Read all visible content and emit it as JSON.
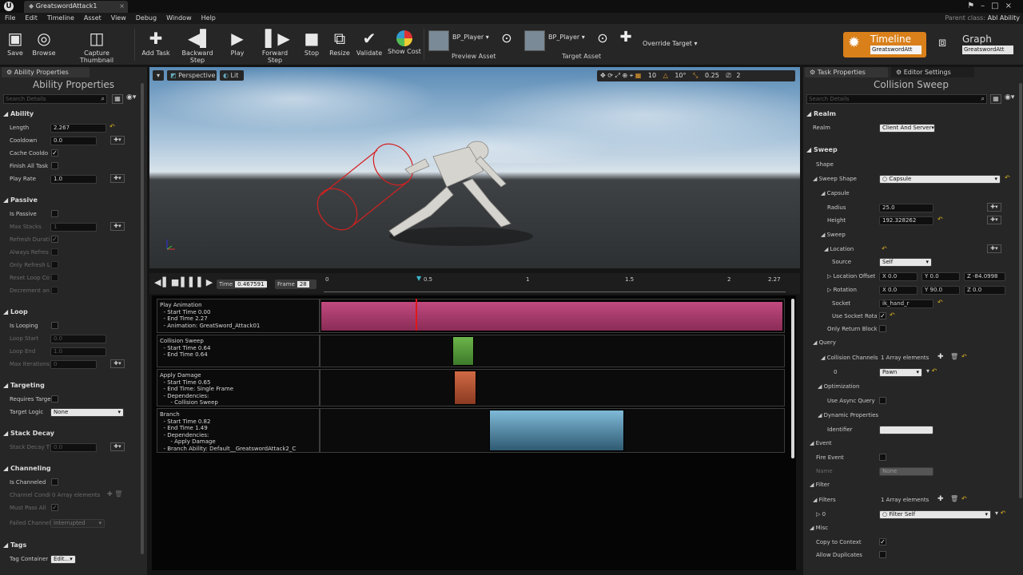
{
  "window": {
    "tab_title": "GreatswordAttack1",
    "parent_class_label": "Parent class:",
    "parent_class_value": "Abl Ability"
  },
  "menu": [
    "File",
    "Edit",
    "Timeline",
    "Asset",
    "View",
    "Debug",
    "Window",
    "Help"
  ],
  "toolbar": {
    "save": "Save",
    "browse": "Browse",
    "capture": "Capture Thumbnail",
    "add_task": "Add Task",
    "backward": "Backward Step",
    "play": "Play",
    "forward": "Forward Step",
    "stop": "Stop",
    "resize": "Resize",
    "validate": "Validate",
    "show_cost": "Show Cost",
    "preview_asset_value": "BP_Player",
    "preview_asset_label": "Preview Asset",
    "target_asset_value": "BP_Player",
    "target_asset_label": "Target Asset",
    "override_target": "Override Target",
    "mode_timeline": "Timeline",
    "mode_timeline_sub": "GreatswordAtt",
    "mode_graph": "Graph",
    "mode_graph_sub": "GreatswordAtt"
  },
  "left_panel": {
    "tab": "Ability Properties",
    "title": "Ability Properties",
    "search_placeholder": "Search Details",
    "ability": {
      "header": "Ability",
      "length_label": "Length",
      "length": "2.267",
      "cooldown_label": "Cooldown",
      "cooldown": "0.0",
      "cache_label": "Cache Cooldo",
      "finish_label": "Finish All Task",
      "playrate_label": "Play Rate",
      "playrate": "1.0"
    },
    "passive": {
      "header": "Passive",
      "is_passive": "Is Passive",
      "max_stacks_label": "Max Stacks",
      "max_stacks": "1",
      "refresh_label": "Refresh Durati",
      "always_label": "Always Refres",
      "only_label": "Only Refresh L",
      "reset_label": "Reset Loop Co",
      "decrement_label": "Decrement an"
    },
    "loop": {
      "header": "Loop",
      "is_looping": "Is Looping",
      "start_label": "Loop Start",
      "start": "0.0",
      "end_label": "Loop End",
      "end": "1.0",
      "max_label": "Max Iterations",
      "max": "0"
    },
    "targeting": {
      "header": "Targeting",
      "requires_label": "Requires Targe",
      "logic_label": "Target Logic",
      "logic": "None"
    },
    "stack_decay": {
      "header": "Stack Decay",
      "label": "Stack Decay T",
      "value": "0.0"
    },
    "channeling": {
      "header": "Channeling",
      "is_label": "Is Channeled",
      "cond_label": "Channel Condi",
      "cond_value": "0 Array elements",
      "must_label": "Must Pass All",
      "failed_label": "Failed Channel",
      "failed_value": "Interrupted"
    },
    "tags": {
      "header": "Tags",
      "container_label": "Tag Container",
      "container_value": "Edit..."
    }
  },
  "viewport": {
    "perspective": "Perspective",
    "lit": "Lit",
    "snap1": "10",
    "snap2": "10°",
    "snap3": "0.25",
    "snap4": "2"
  },
  "timeline": {
    "time_label": "Time",
    "time_value": "0.467591",
    "frame_label": "Frame",
    "frame_value": "28",
    "ruler": [
      "0",
      "0.5",
      "1",
      "1.5",
      "2",
      "2.27"
    ],
    "tracks": [
      {
        "text": "Play Animation\n  - Start Time 0.00\n  - End Time 2.27\n  - Animation: GreatSword_Attack01"
      },
      {
        "text": "Collision Sweep\n  - Start Time 0.64\n  - End Time 0.64"
      },
      {
        "text": "Apply Damage\n  - Start Time 0.65\n  - End Time: Single Frame\n  - Dependencies:\n      - Collision Sweep"
      },
      {
        "text": "Branch\n  - Start Time 0.82\n  - End Time 1.49\n  - Dependencies:\n      - Apply Damage\n  - Branch Ability: Default__GreatswordAttack2_C"
      }
    ],
    "colors": {
      "anim": "#b0406f",
      "sweep": "#5fa040",
      "damage": "#c2603c",
      "branch": "#6aa6c8",
      "playhead": "#e01818"
    }
  },
  "right_panel": {
    "tab1": "Task Properties",
    "tab2": "Editor Settings",
    "title": "Collision Sweep",
    "search_placeholder": "Search Details",
    "realm": {
      "header": "Realm",
      "label": "Realm",
      "value": "Client And Server"
    },
    "sweep": {
      "header": "Sweep",
      "shape_header": "Shape",
      "sweep_shape_label": "Sweep Shape",
      "sweep_shape_value": "Capsule",
      "capsule_header": "Capsule",
      "radius_label": "Radius",
      "radius": "25.0",
      "height_label": "Height",
      "height": "192.328262",
      "sweep_sub": "Sweep",
      "location_label": "Location",
      "source_label": "Source",
      "source": "Self",
      "loc_offset_label": "Location Offset",
      "loc_x": "0.0",
      "loc_y": "0.0",
      "loc_z": "-84.0998",
      "rotation_label": "Rotation",
      "rot_x": "0.0",
      "rot_y": "90.0",
      "rot_z": "0.0",
      "socket_label": "Socket",
      "socket": "ik_hand_r",
      "use_socket_label": "Use Socket Rota",
      "only_return_label": "Only Return Block"
    },
    "query": {
      "header": "Query",
      "channels_label": "Collision Channels",
      "channels_value": "1 Array elements",
      "idx0": "0",
      "idx0_value": "Pawn"
    },
    "optimization": {
      "header": "Optimization",
      "async_label": "Use Async Query"
    },
    "dynamic": {
      "header": "Dynamic Properties",
      "identifier_label": "Identifier"
    },
    "event": {
      "header": "Event",
      "fire_label": "Fire Event",
      "name_label": "Name",
      "name_value": "None"
    },
    "filter": {
      "header": "Filter",
      "filters_label": "Filters",
      "filters_value": "1 Array elements",
      "idx0": "0",
      "idx0_value": "Filter Self"
    },
    "misc": {
      "header": "Misc",
      "copy_label": "Copy to Context",
      "allow_label": "Allow Duplicates"
    }
  }
}
